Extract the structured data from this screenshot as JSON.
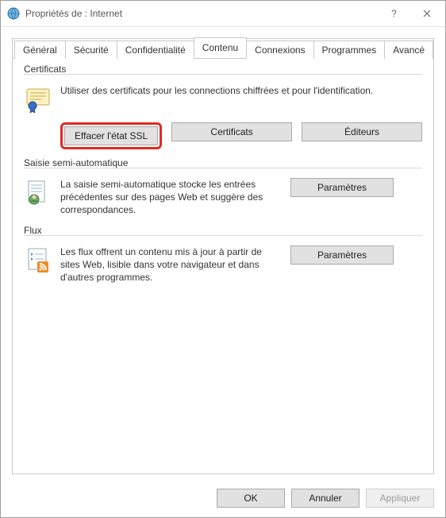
{
  "window": {
    "title": "Propriétés de : Internet"
  },
  "tabs": {
    "general": "Général",
    "security": "Sécurité",
    "privacy": "Confidentialité",
    "content": "Contenu",
    "connections": "Connexions",
    "programs": "Programmes",
    "advanced": "Avancé"
  },
  "certificates": {
    "group_label": "Certificats",
    "description": "Utiliser des certificats pour les connections chiffrées et pour l'identification.",
    "clear_ssl": "Effacer l'état SSL",
    "certificates_btn": "Certificats",
    "publishers_btn": "Éditeurs"
  },
  "autocomplete": {
    "group_label": "Saisie semi-automatique",
    "description": "La saisie semi-automatique stocke les entrées précédentes sur des pages Web et suggère des correspondances.",
    "settings_btn": "Paramètres"
  },
  "feeds": {
    "group_label": "Flux",
    "description": "Les flux offrent un contenu mis à jour à partir de sites Web, lisible dans votre navigateur et dans d'autres programmes.",
    "settings_btn": "Paramètres"
  },
  "footer": {
    "ok": "OK",
    "cancel": "Annuler",
    "apply": "Appliquer"
  }
}
